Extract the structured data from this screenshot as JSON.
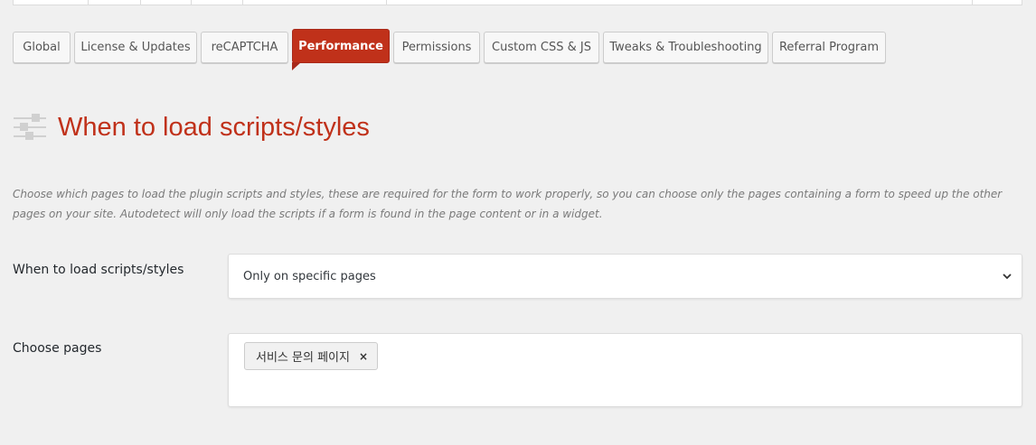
{
  "tabs": [
    {
      "label": "Global"
    },
    {
      "label": "License & Updates"
    },
    {
      "label": "reCAPTCHA"
    },
    {
      "label": "Performance",
      "active": true
    },
    {
      "label": "Permissions"
    },
    {
      "label": "Custom CSS & JS"
    },
    {
      "label": "Tweaks & Troubleshooting"
    },
    {
      "label": "Referral Program"
    }
  ],
  "section": {
    "title": "When to load scripts/styles",
    "icon": "sliders-icon",
    "description": "Choose which pages to load the plugin scripts and styles, these are required for the form to work properly, so you can choose only the pages containing a form to speed up the other pages on your site. Autodetect will only load the scripts if a form is found in the page content or in a widget."
  },
  "load_setting": {
    "label": "When to load scripts/styles",
    "selected": "Only on specific pages"
  },
  "pages_setting": {
    "label": "Choose pages",
    "chips": [
      {
        "label": "서비스 문의 페이지",
        "remove": "×"
      }
    ]
  },
  "colors": {
    "accent": "#c0311a",
    "background": "#f0f0f0"
  }
}
